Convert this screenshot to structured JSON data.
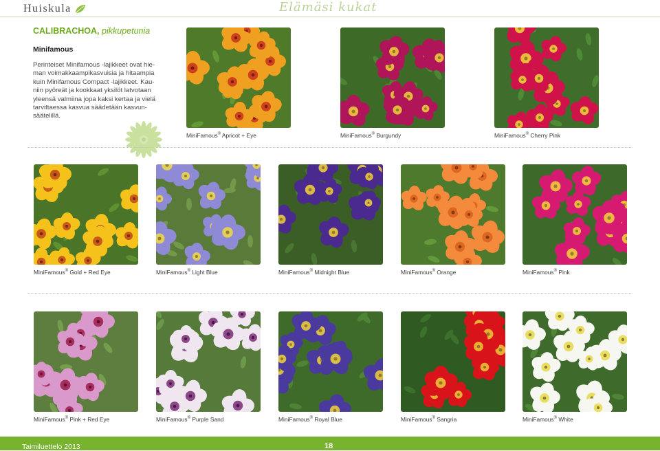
{
  "header": {
    "brand": "Huiskula",
    "slogan": "Elämäsi kukat"
  },
  "intro": {
    "title": "CALIBRACHOA,",
    "subtitle": "pikkupetunia",
    "series": "Minifamous",
    "body": "Perinteiset Minifamous -lajikkeet ovat hie-\nman voimakkaampikasvuisia ja hitaampia\nkuin Minifamous Compact -lajikkeet. Kau-\nniin pyöreät ja kookkaat yksilöt latvotaan\nyleensä valmiina jopa kaksi kertaa ja vielä\ntarvittaessa kasvua säädetään kasvun-\nsäätelillä."
  },
  "products": [
    {
      "brand": "MiniFamous",
      "reg": "®",
      "variety": "Apricot + Eye",
      "flower": "#f0a020",
      "center": "#c9301c",
      "leaf": "#4e7a2a"
    },
    {
      "brand": "MiniFamous",
      "reg": "®",
      "variety": "Burgundy",
      "flower": "#b0155a",
      "center": "#f2d23c",
      "leaf": "#3e6a28"
    },
    {
      "brand": "MiniFamous",
      "reg": "®",
      "variety": "Cherry Pink",
      "flower": "#d0124a",
      "center": "#f4d83a",
      "leaf": "#3f6e2c"
    },
    {
      "brand": "MiniFamous",
      "reg": "®",
      "variety": "Gold + Red Eye",
      "flower": "#f4c21a",
      "center": "#c0461c",
      "leaf": "#4a7428"
    },
    {
      "brand": "MiniFamous",
      "reg": "®",
      "variety": "Light Blue",
      "flower": "#8e8ad6",
      "center": "#f1d846",
      "leaf": "#5a7a3a"
    },
    {
      "brand": "MiniFamous",
      "reg": "®",
      "variety": "Midnight Blue",
      "flower": "#4a2a8e",
      "center": "#f3d23a",
      "leaf": "#3a5e26"
    },
    {
      "brand": "MiniFamous",
      "reg": "®",
      "variety": "Orange",
      "flower": "#f48a3c",
      "center": "#d8601c",
      "leaf": "#4e7a2e"
    },
    {
      "brand": "MiniFamous",
      "reg": "®",
      "variety": "Pink",
      "flower": "#d61a72",
      "center": "#f6d43c",
      "leaf": "#3d6a2a"
    },
    {
      "brand": "MiniFamous",
      "reg": "®",
      "variety": "Pink + Red Eye",
      "flower": "#d99acb",
      "center": "#9c1a4a",
      "leaf": "#5d7e3e"
    },
    {
      "brand": "MiniFamous",
      "reg": "®",
      "variety": "Purple Sand",
      "flower": "#efe6ef",
      "center": "#7a2a76",
      "leaf": "#557a3a"
    },
    {
      "brand": "MiniFamous",
      "reg": "®",
      "variety": "Royal Blue",
      "flower": "#4b3a9e",
      "center": "#f2d43a",
      "leaf": "#3e6a2a"
    },
    {
      "brand": "MiniFamous",
      "reg": "®",
      "variety": "Sangria",
      "flower": "#d8141a",
      "center": "#f2c83a",
      "leaf": "#2f5a22"
    },
    {
      "brand": "MiniFamous",
      "reg": "®",
      "variety": "White",
      "flower": "#f7f7f2",
      "center": "#e8d84a",
      "leaf": "#3e6a2c"
    }
  ],
  "footer": {
    "catalog": "Taimiluettelo 2013",
    "page": "18"
  },
  "colors": {
    "accent": "#6cab1a",
    "footer_bg": "#78b330"
  }
}
